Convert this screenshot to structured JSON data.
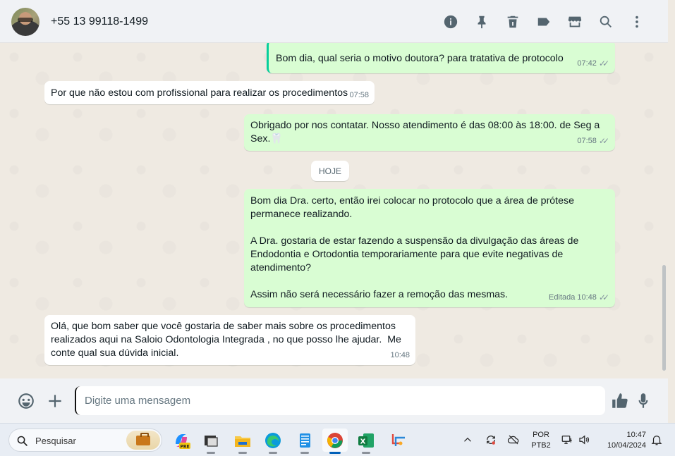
{
  "header": {
    "contact_name": "+55 13 99118-1499",
    "icons": [
      "info-icon",
      "pin-icon",
      "delete-icon",
      "label-icon",
      "store-icon",
      "search-icon",
      "menu-icon"
    ]
  },
  "messages": [
    {
      "direction": "out",
      "text": "Bom dia, qual seria o motivo doutora? para tratativa de protocolo",
      "time": "07:42",
      "status": "read"
    },
    {
      "direction": "in",
      "text": "Por que não estou com profissional para realizar os procedimentos",
      "time": "07:58"
    },
    {
      "direction": "out",
      "text": "Obrigado por nos contatar. Nosso atendimento é das 08:00 às 18:00. de Seg a Sex.🦷",
      "time": "07:58",
      "status": "read"
    },
    {
      "direction": "out",
      "text": "Bom dia Dra. certo, então irei colocar no protocolo que a área de prótese permanece realizando.\n\nA Dra. gostaria de estar fazendo a suspensão da divulgação das áreas de Endodontia e Ortodontia temporariamente para que evite negativas de atendimento?\n\nAssim não será necessário fazer a remoção das mesmas.",
      "edited_label": "Editada",
      "time": "10:48",
      "status": "read"
    },
    {
      "direction": "in",
      "text": "Olá, que bom saber que você gostaria de saber mais sobre os procedimentos realizados aqui na Saloio Odontologia Integrada , no que posso lhe ajudar.  Me conte qual sua dúvida inicial.",
      "time": "10:48"
    }
  ],
  "date_separator": "HOJE",
  "composer": {
    "placeholder": "Digite uma mensagem",
    "value": ""
  },
  "taskbar": {
    "search_placeholder": "Pesquisar",
    "language_line1": "POR",
    "language_line2": "PTB2",
    "time": "10:47",
    "date": "10/04/2024"
  },
  "colors": {
    "outgoing_bubble": "#d9fdd3",
    "incoming_bubble": "#ffffff",
    "chat_background": "#efeae2",
    "header_background": "#f0f2f5",
    "read_ticks": "#8696a0"
  }
}
